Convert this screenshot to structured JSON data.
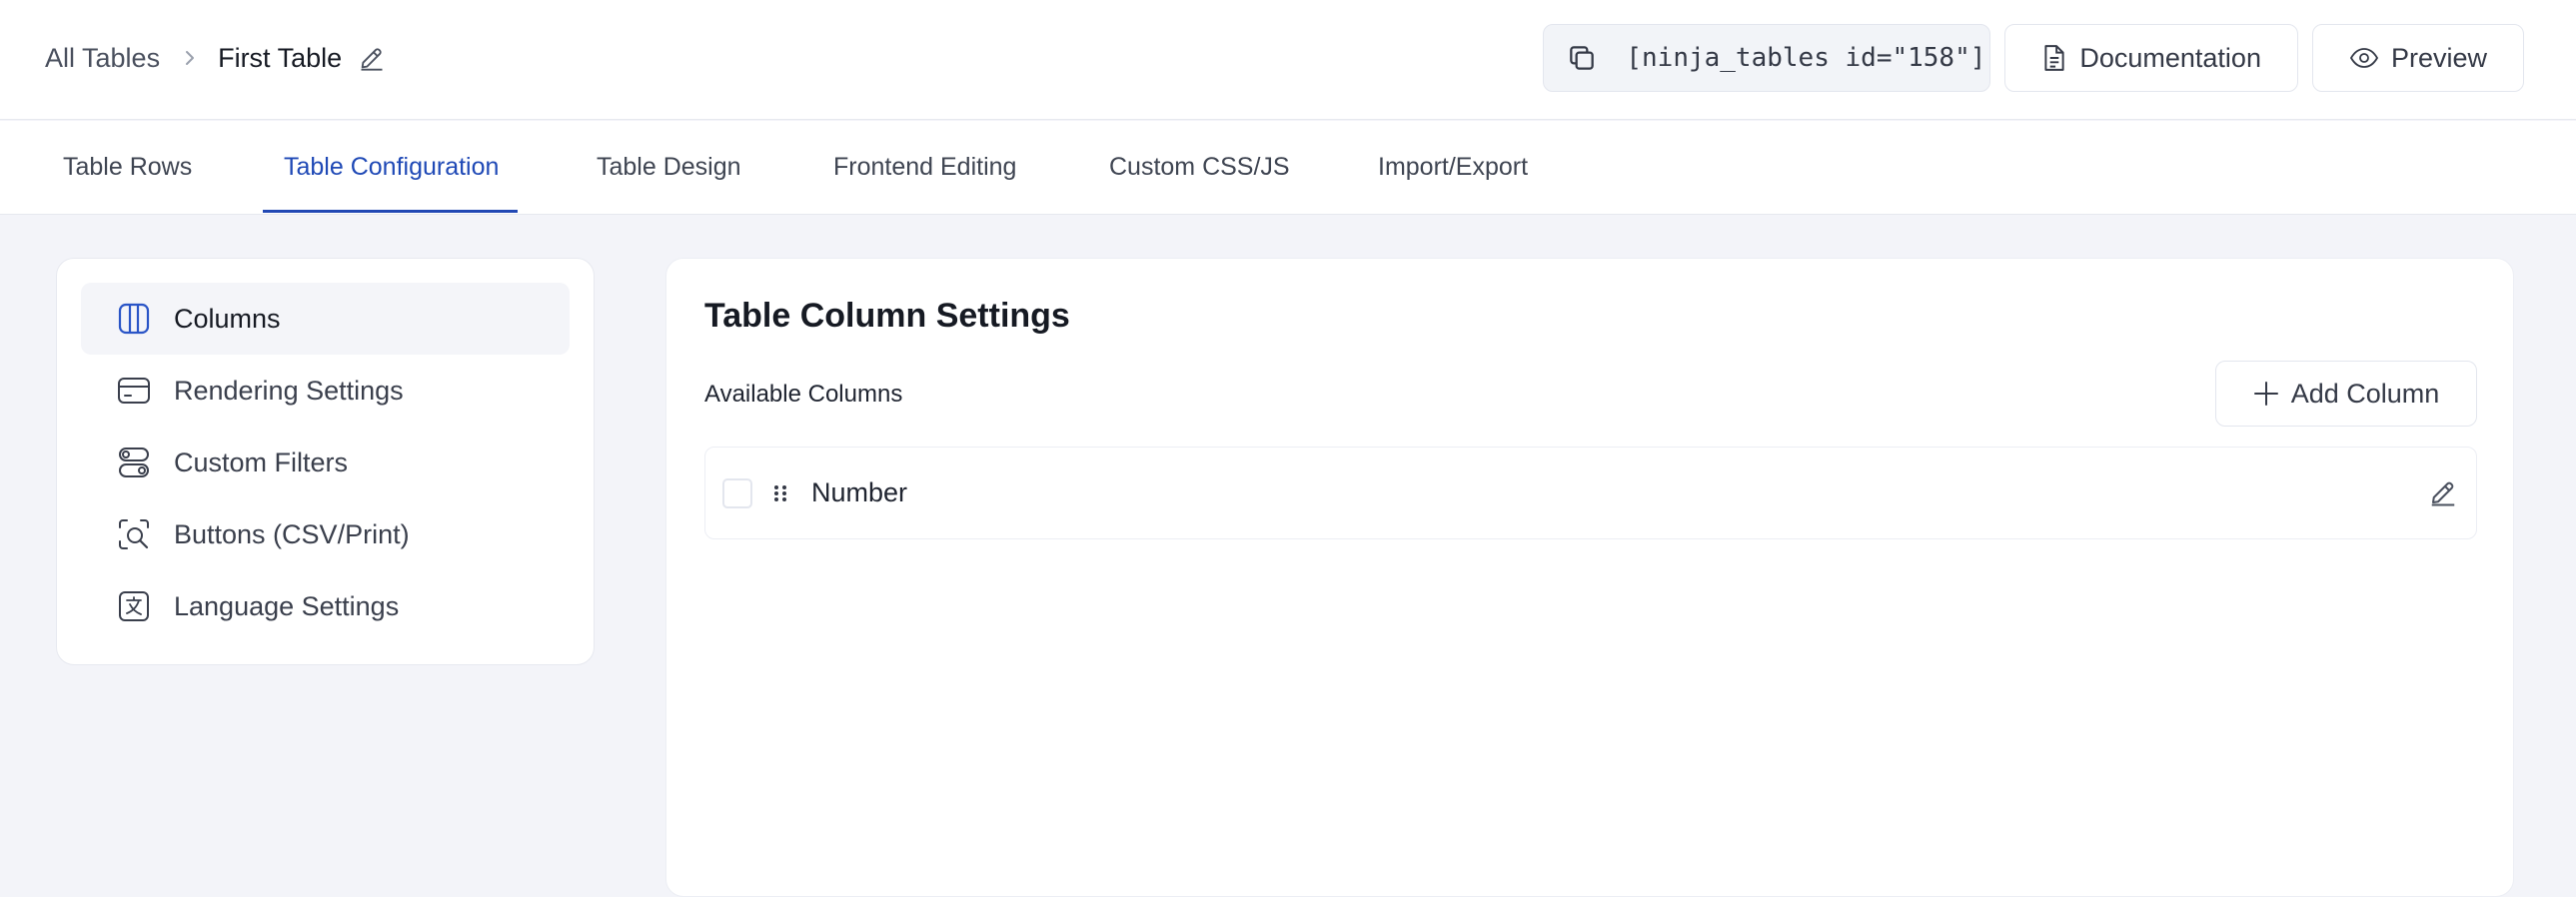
{
  "breadcrumb": {
    "root": "All Tables",
    "current": "First Table"
  },
  "header": {
    "shortcode": "[ninja_tables id=\"158\"]",
    "documentation_label": "Documentation",
    "preview_label": "Preview"
  },
  "tabs": [
    {
      "label": "Table Rows"
    },
    {
      "label": "Table Configuration",
      "active": true
    },
    {
      "label": "Table Design"
    },
    {
      "label": "Frontend Editing"
    },
    {
      "label": "Custom CSS/JS"
    },
    {
      "label": "Import/Export"
    }
  ],
  "sidebar": {
    "items": [
      {
        "label": "Columns",
        "icon": "columns-icon",
        "active": true
      },
      {
        "label": "Rendering Settings",
        "icon": "card-icon"
      },
      {
        "label": "Custom Filters",
        "icon": "filter-toggles-icon"
      },
      {
        "label": "Buttons (CSV/Print)",
        "icon": "scan-search-icon"
      },
      {
        "label": "Language Settings",
        "icon": "translate-icon"
      }
    ]
  },
  "main": {
    "title": "Table Column Settings",
    "available_label": "Available Columns",
    "add_column_label": "Add Column",
    "columns": [
      {
        "name": "Number"
      }
    ]
  },
  "colors": {
    "accent": "#1f49b6",
    "page_bg": "#f3f4f9",
    "border": "#e6e8ef"
  }
}
